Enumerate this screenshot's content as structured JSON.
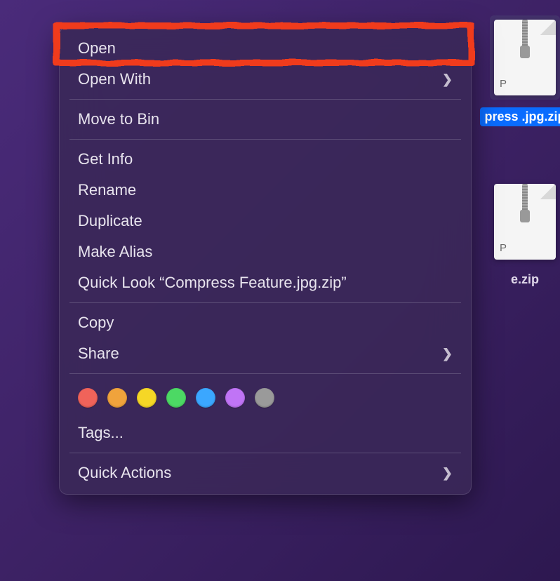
{
  "desktop": {
    "files": [
      {
        "label_partial": "press\n.jpg.zip",
        "selected": true,
        "zip_ext": "P"
      },
      {
        "label_partial": "e.zip",
        "selected": false,
        "zip_ext": "P"
      }
    ]
  },
  "context_menu": {
    "open": "Open",
    "open_with": "Open With",
    "move_to_bin": "Move to Bin",
    "get_info": "Get Info",
    "rename": "Rename",
    "duplicate": "Duplicate",
    "make_alias": "Make Alias",
    "quick_look": "Quick Look “Compress Feature.jpg.zip”",
    "copy": "Copy",
    "share": "Share",
    "tags": "Tags...",
    "quick_actions": "Quick Actions",
    "tag_colors": [
      "#f0635a",
      "#f0a33c",
      "#f5d726",
      "#4cd964",
      "#3ba7ff",
      "#c074f6",
      "#9a9a9a"
    ]
  },
  "highlight": {
    "target": "open-menu-item"
  }
}
